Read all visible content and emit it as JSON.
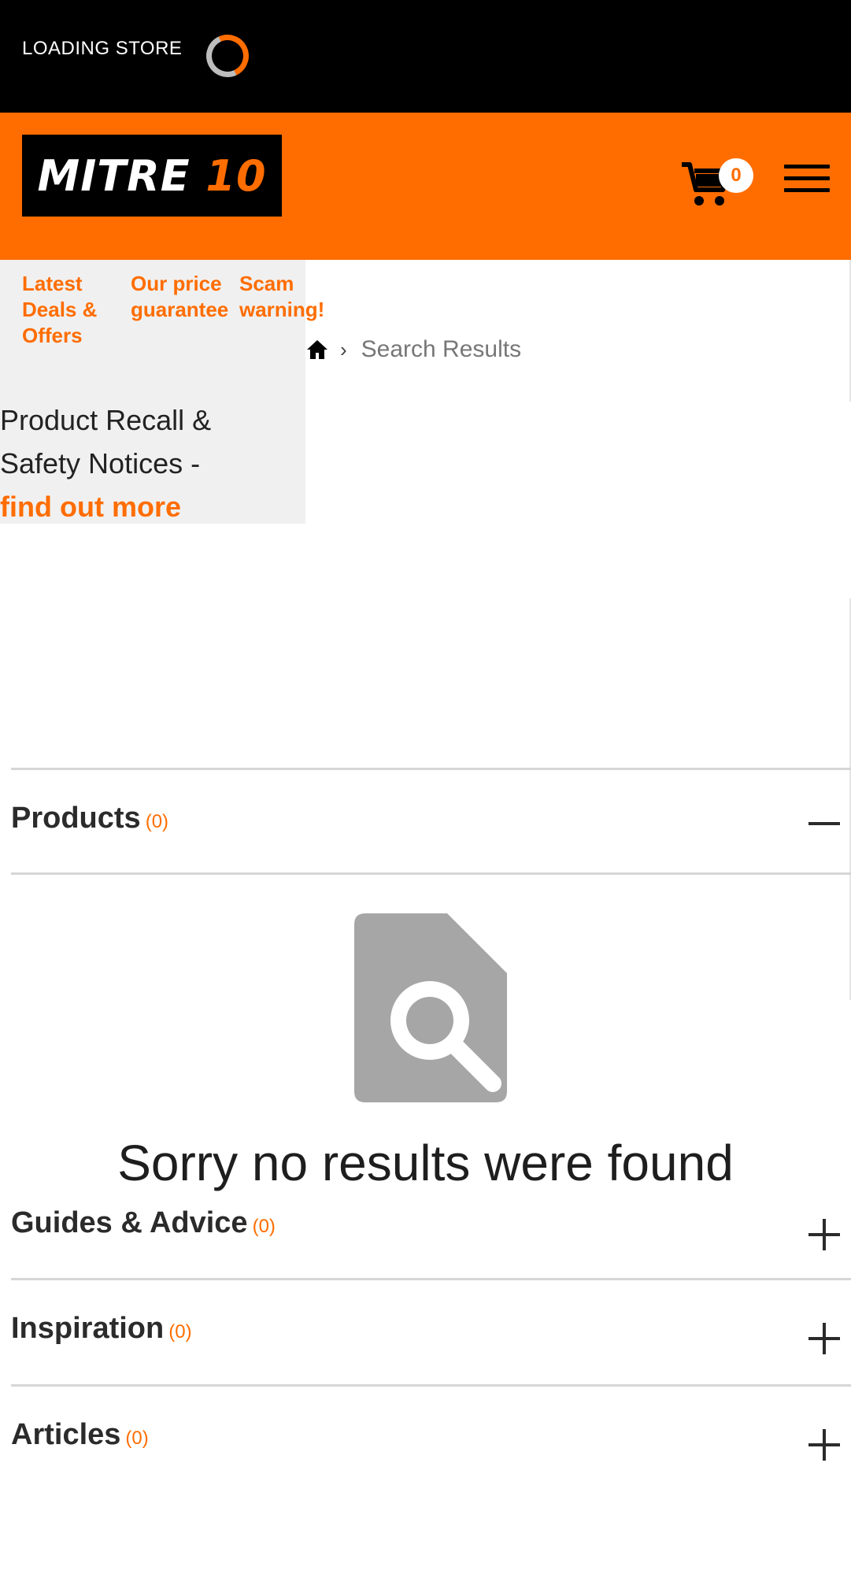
{
  "store_bar": {
    "loading_label": "LOADING STORE"
  },
  "header": {
    "logo_text": "MITRE ",
    "logo_number": "10",
    "cart_count": "0",
    "brand_color": "#ff6d00"
  },
  "promo": {
    "links": [
      {
        "label": "Latest Deals & Offers"
      },
      {
        "label": "Our price guarantee"
      },
      {
        "label": "Scam warning!"
      }
    ],
    "recall_text": "Product Recall & Safety Notices -",
    "recall_link": "find out more"
  },
  "breadcrumb": {
    "separator": "›",
    "current": "Search Results"
  },
  "sections": [
    {
      "title": "Products",
      "count": "(0)",
      "expanded": true
    },
    {
      "title": "Guides & Advice",
      "count": "(0)",
      "expanded": false
    },
    {
      "title": "Inspiration",
      "count": "(0)",
      "expanded": false
    },
    {
      "title": "Articles",
      "count": "(0)",
      "expanded": false
    }
  ],
  "empty_state": {
    "icon": "document-search-icon",
    "message": "Sorry no results were found"
  }
}
